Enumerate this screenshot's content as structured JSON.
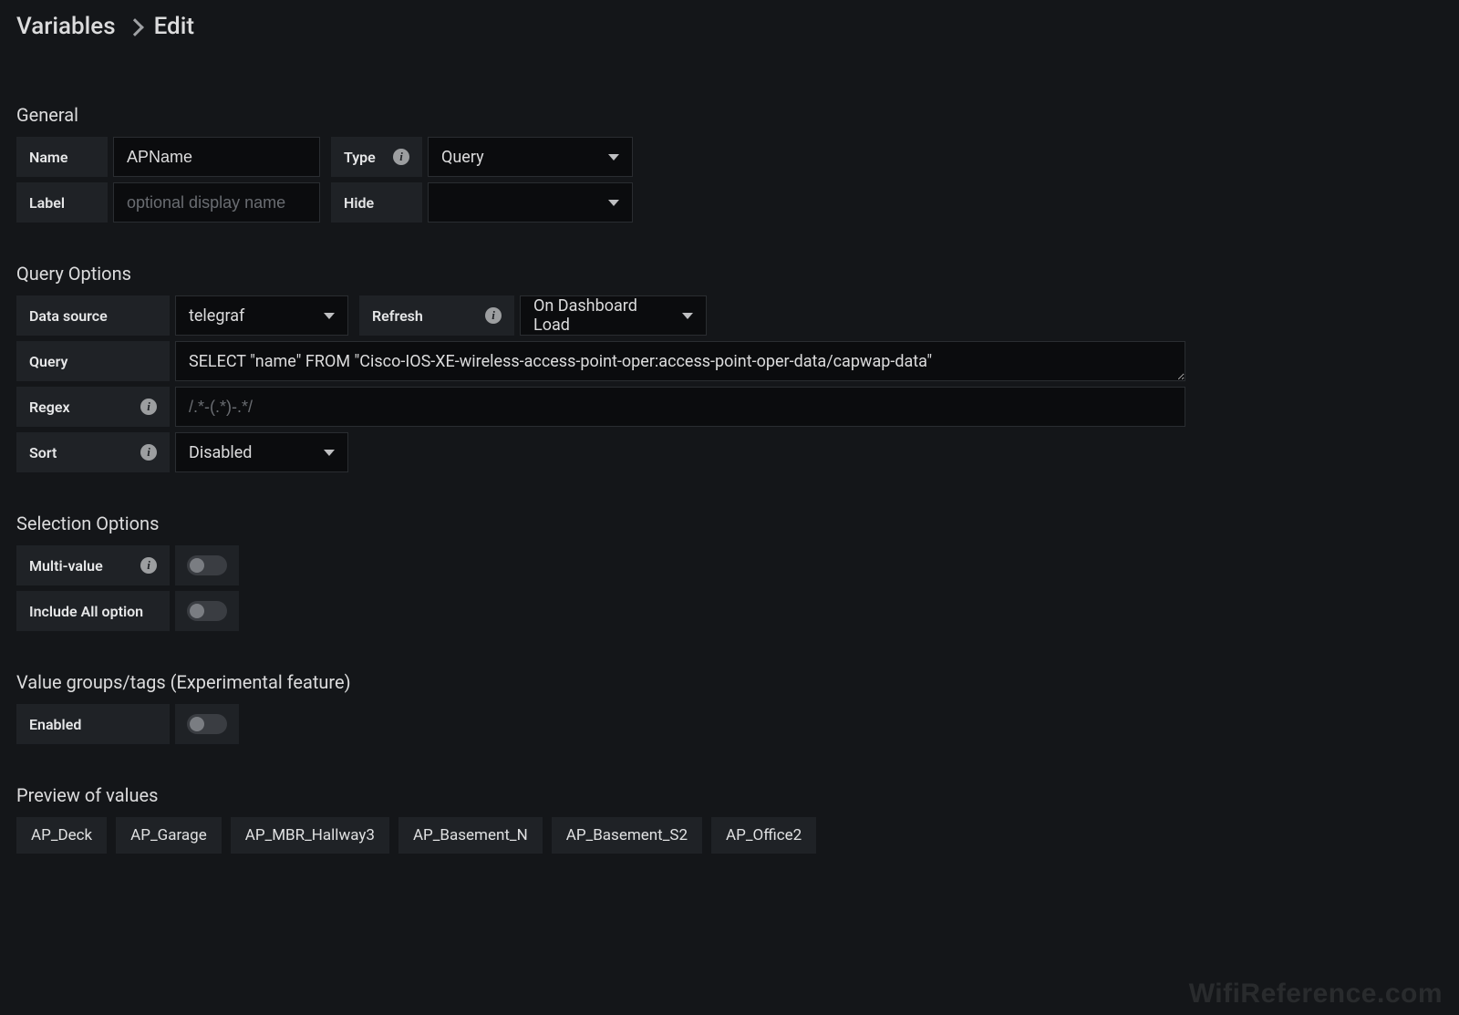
{
  "breadcrumb": {
    "root": "Variables",
    "current": "Edit"
  },
  "general": {
    "title": "General",
    "name_label": "Name",
    "name_value": "APName",
    "type_label": "Type",
    "type_value": "Query",
    "label_label": "Label",
    "label_placeholder": "optional display name",
    "label_value": "",
    "hide_label": "Hide",
    "hide_value": ""
  },
  "query_options": {
    "title": "Query Options",
    "datasource_label": "Data source",
    "datasource_value": "telegraf",
    "refresh_label": "Refresh",
    "refresh_value": "On Dashboard Load",
    "query_label": "Query",
    "query_value": "SELECT \"name\" FROM \"Cisco-IOS-XE-wireless-access-point-oper:access-point-oper-data/capwap-data\"",
    "regex_label": "Regex",
    "regex_placeholder": "/.*-(.*)-.*/",
    "regex_value": "",
    "sort_label": "Sort",
    "sort_value": "Disabled"
  },
  "selection_options": {
    "title": "Selection Options",
    "multi_value_label": "Multi-value",
    "multi_value_on": false,
    "include_all_label": "Include All option",
    "include_all_on": false
  },
  "value_groups": {
    "title": "Value groups/tags (Experimental feature)",
    "enabled_label": "Enabled",
    "enabled_on": false
  },
  "preview": {
    "title": "Preview of values",
    "values": [
      "AP_Deck",
      "AP_Garage",
      "AP_MBR_Hallway3",
      "AP_Basement_N",
      "AP_Basement_S2",
      "AP_Office2"
    ]
  },
  "watermark": "WifiReference.com"
}
